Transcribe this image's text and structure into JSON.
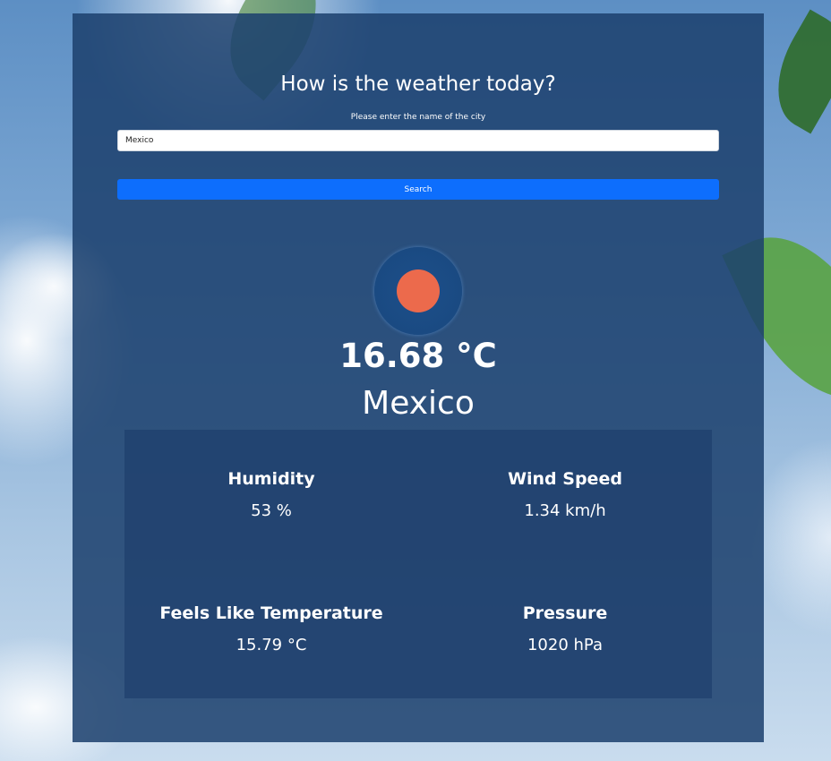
{
  "header": {
    "title": "How is the weather today?"
  },
  "search": {
    "label": "Please enter the name of the city",
    "value": "Mexico",
    "button_label": "Search"
  },
  "weather": {
    "icon": "sun-icon",
    "icon_color": "#ec6a4c",
    "temperature": "16.68 °C",
    "city": "Mexico"
  },
  "details": {
    "humidity_label": "Humidity",
    "humidity_value": "53 %",
    "wind_label": "Wind Speed",
    "wind_value": "1.34 km/h",
    "feels_label": "Feels Like Temperature",
    "feels_value": "15.79 °C",
    "pressure_label": "Pressure",
    "pressure_value": "1020 hPa"
  },
  "colors": {
    "accent": "#0d6efd",
    "panel": "#1c406e"
  }
}
